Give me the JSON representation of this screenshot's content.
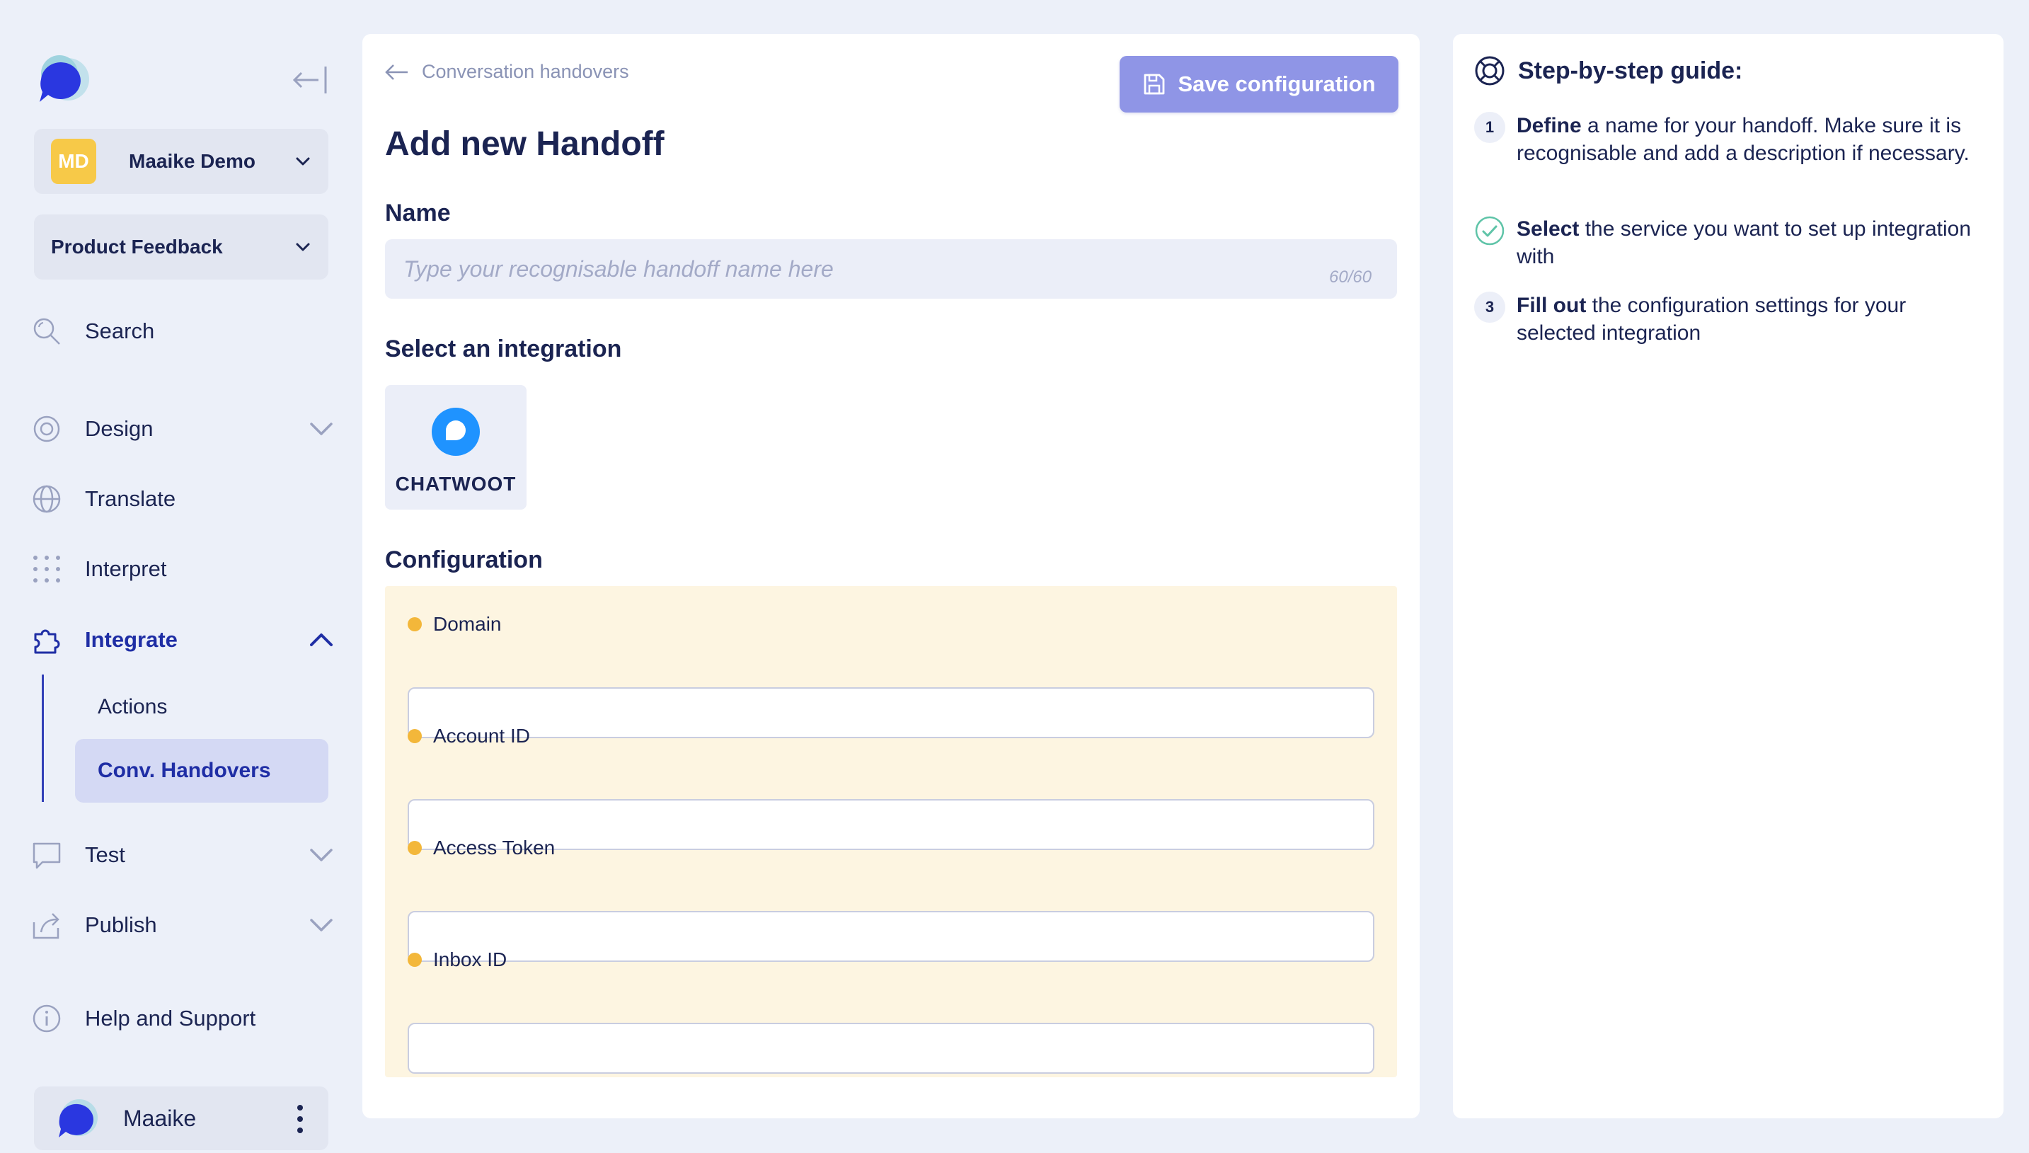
{
  "sidebar": {
    "workspace": {
      "initials": "MD",
      "name": "Maaike Demo"
    },
    "project": {
      "name": "Product Feedback"
    },
    "nav": {
      "search": "Search",
      "design": "Design",
      "translate": "Translate",
      "interpret": "Interpret",
      "integrate": "Integrate",
      "integrate_sub": {
        "actions": "Actions",
        "handovers": "Conv. Handovers"
      },
      "test": "Test",
      "publish": "Publish",
      "help": "Help and Support"
    },
    "user": {
      "name": "Maaike"
    }
  },
  "main": {
    "back_label": "Conversation handovers",
    "save_label": "Save configuration",
    "title": "Add new Handoff",
    "name_section": "Name",
    "name_placeholder": "Type your recognisable handoff name here",
    "name_count": "60/60",
    "integration_section": "Select an integration",
    "integrations": [
      {
        "label": "CHATWOOT",
        "icon": "chatwoot-icon"
      }
    ],
    "config_section": "Configuration",
    "fields": [
      {
        "label": "Domain",
        "value": ""
      },
      {
        "label": "Account ID",
        "value": ""
      },
      {
        "label": "Access Token",
        "value": ""
      },
      {
        "label": "Inbox ID",
        "value": ""
      }
    ]
  },
  "guide": {
    "title": "Step-by-step guide:",
    "steps": [
      {
        "marker": "1",
        "bold": "Define",
        "rest": " a name for your handoff. Make sure it is recognisable and add a description if necessary."
      },
      {
        "marker": "check",
        "bold": "Select",
        "rest": " the service you want to set up integration with"
      },
      {
        "marker": "3",
        "bold": "Fill out",
        "rest": " the configuration settings for your selected integration"
      }
    ]
  },
  "colors": {
    "background": "#ecf0f9",
    "primary": "#1f2ea5",
    "save_button": "#8f95e6",
    "config_bg": "#fdf5e1",
    "required_dot": "#f3b73a",
    "badge": "#f7c948",
    "chatwoot": "#1f93ff"
  }
}
